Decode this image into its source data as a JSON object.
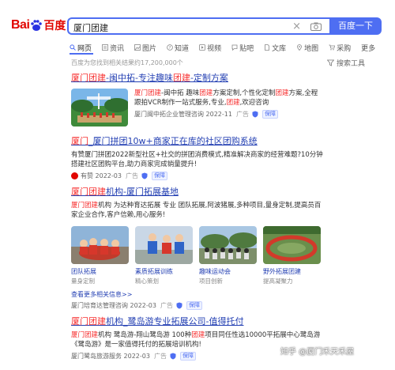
{
  "logo": {
    "left": "Bai",
    "right": "百度"
  },
  "search": {
    "query": "厦门团建",
    "clear": "×",
    "button": "百度一下"
  },
  "tabs": [
    {
      "label": "网页",
      "icon": "search-icon"
    },
    {
      "label": "资讯",
      "icon": "news-icon"
    },
    {
      "label": "图片",
      "icon": "image-icon"
    },
    {
      "label": "知道",
      "icon": "question-icon"
    },
    {
      "label": "视频",
      "icon": "video-icon"
    },
    {
      "label": "贴吧",
      "icon": "tieba-icon"
    },
    {
      "label": "文库",
      "icon": "doc-icon"
    },
    {
      "label": "地图",
      "icon": "map-icon"
    },
    {
      "label": "采购",
      "icon": "cart-icon"
    },
    {
      "label": "更多",
      "icon": ""
    }
  ],
  "result_count": "百度为您找到相关结果约17,200,000个",
  "tools": "搜索工具",
  "results": {
    "r1": {
      "title_a": "厦门团建",
      "title_b": "-闽中拓-专注趣味",
      "title_c": "团建",
      "title_d": "-定制方案",
      "text_a": "厦门团建",
      "text_b": "-闽中拓 趣味",
      "text_c": "团建",
      "text_d": "方案定制,个性化定制",
      "text_e": "团建",
      "text_f": "方案,全程跟拍VCR制作一站式服务,专业,",
      "text_g": "团建",
      "text_h": ",欢迎咨询",
      "source": "厦门闽中拓企业管理咨询 2022-11",
      "ad": "广告",
      "badge": "保障"
    },
    "r2": {
      "title_a": "厦门",
      "title_b": "_厦门拼团10w+商家正在库的社区团购系统",
      "text": "有赞厦门拼团2022新型社区+社交的拼团消费模式,精准解决商家的经营难题?10分钟搭建社区团购平台,助力商家完成销量提升!",
      "source_icon": "youzan-logo",
      "source": "有赞 2022-03",
      "ad": "广告",
      "badge": "保障"
    },
    "r3": {
      "title_a": "厦门团建",
      "title_b": "机构-厦门拓展基地",
      "text_a": "厦门团建",
      "text_b": "机构 为达种育达拓展 专业 团队拓展,阿波猪展,多种项目,量身定制,提高员百家企业合作,客户信赖,用心服务!",
      "gallery": [
        {
          "caption": "团队拓展",
          "sub": "量身定制"
        },
        {
          "caption": "素质拓展训练",
          "sub": "精心策划"
        },
        {
          "caption": "趣味运动会",
          "sub": "项目创新"
        },
        {
          "caption": "野外拓展团建",
          "sub": "提高凝聚力"
        }
      ],
      "more": "查看更多相关信息>>",
      "source": "厦门培育达管理咨询 2022-03",
      "ad": "广告",
      "badge": "保障"
    },
    "r4": {
      "title_a": "厦门团建",
      "title_b": "机构_鹭岛游专业拓展公司-值得托付",
      "text_a": "厦门团建",
      "text_b": "机构 鹭岛游-翔山鹭岛游 100种",
      "text_c": "团建",
      "text_d": "项目同任性选10000平拓展中心鹭岛游《鹭岛游》是一家值得托付的拓展培训机构!",
      "source": "厦门鹭岛旅游服务 2022-03",
      "ad": "广告",
      "badge": "保障"
    }
  },
  "watermark": "知乎 @厦门禾天禾屋",
  "colors": {
    "accent": "#4e6ef2",
    "highlight": "#f73131",
    "link": "#2440b3",
    "brand": "#e10601"
  }
}
